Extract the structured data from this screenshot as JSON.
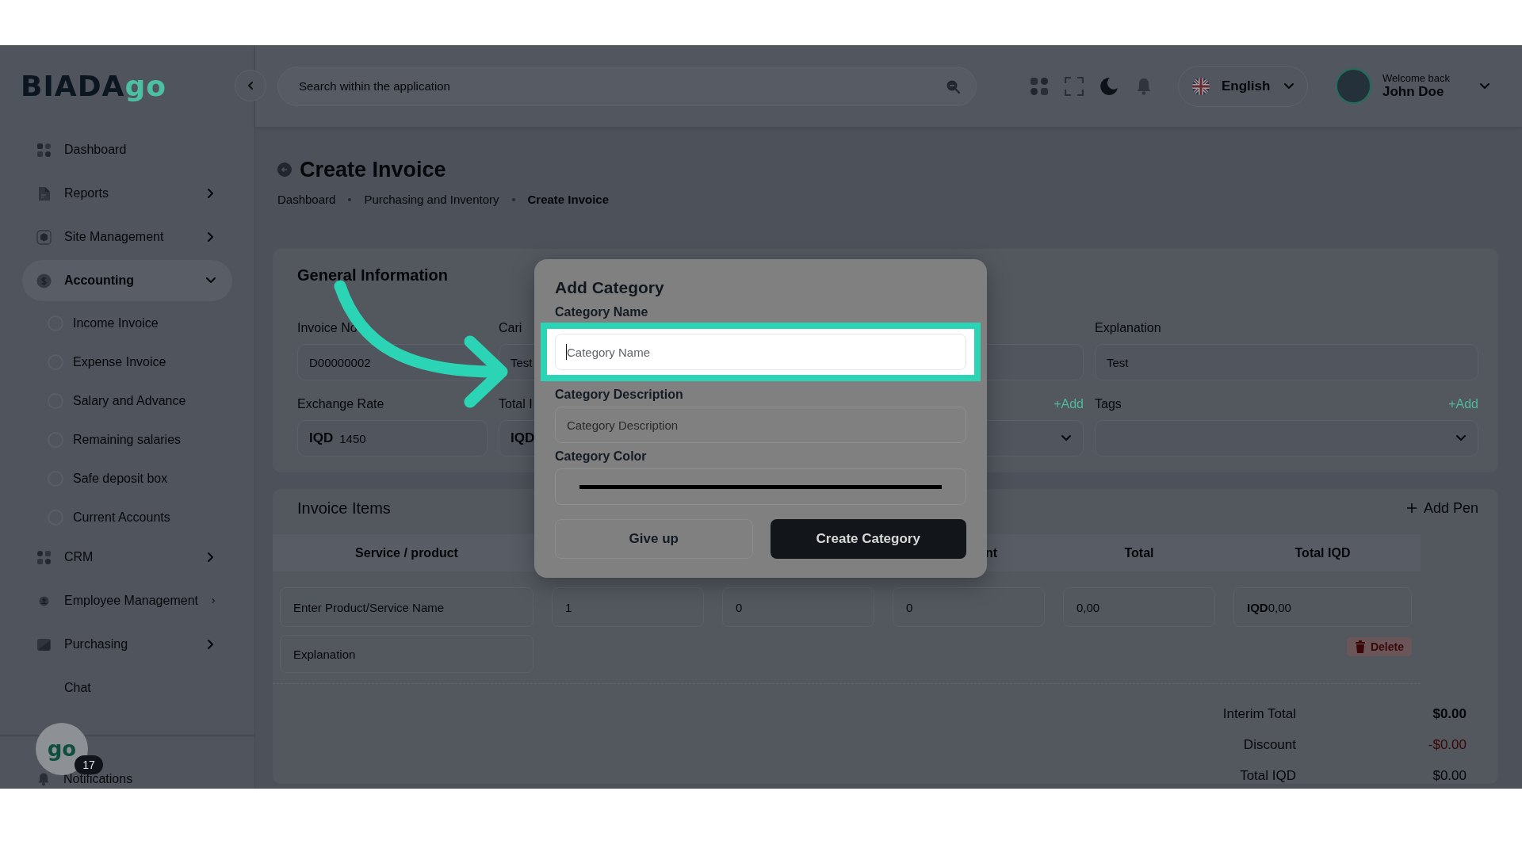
{
  "sidebar": {
    "logo": {
      "text": "BIADA",
      "accent": "go"
    },
    "items": [
      {
        "label": "Dashboard",
        "kind": "link",
        "selected": false
      },
      {
        "label": "Reports",
        "kind": "group",
        "selected": false,
        "expanded": false
      },
      {
        "label": "Site Management",
        "kind": "group",
        "selected": false,
        "expanded": false
      },
      {
        "label": "Accounting",
        "kind": "group",
        "selected": true,
        "expanded": true,
        "children": [
          {
            "label": "Income Invoice",
            "selected": false
          },
          {
            "label": "Expense Invoice",
            "selected": false
          },
          {
            "label": "Salary and Advance",
            "selected": false
          },
          {
            "label": "Remaining salaries",
            "selected": false
          },
          {
            "label": "Safe deposit box",
            "selected": false
          },
          {
            "label": "Current Accounts",
            "selected": false
          }
        ]
      },
      {
        "label": "CRM",
        "kind": "group",
        "selected": false,
        "expanded": false
      },
      {
        "label": "Employee Management",
        "kind": "group",
        "selected": false,
        "expanded": false
      },
      {
        "label": "Purchasing",
        "kind": "group",
        "selected": false,
        "expanded": false
      },
      {
        "label": "Chat",
        "kind": "link",
        "selected": false
      }
    ],
    "chat_bubble": {
      "logo": "go",
      "badge": "17"
    },
    "notifications": "Notifications"
  },
  "header": {
    "search": {
      "placeholder": "Search within the application"
    },
    "language": "English",
    "user": {
      "greeting": "Welcome back",
      "name": "John Doe"
    }
  },
  "page": {
    "title": "Create Invoice",
    "breadcrumbs": [
      {
        "label": "Dashboard",
        "current": false
      },
      {
        "label": "Purchasing and Inventory",
        "current": false
      },
      {
        "label": "Create Invoice",
        "current": true
      }
    ]
  },
  "general_information": {
    "title": "General Information",
    "fields": [
      {
        "kind": "text",
        "label": "Invoice No",
        "value": "D00000002"
      },
      {
        "kind": "text",
        "label": "Cari",
        "value": "Test"
      },
      {
        "kind": "text"
      },
      {
        "kind": "text",
        "label": "Explanation",
        "value": "Test"
      },
      {
        "kind": "currency",
        "label": "Exchange Rate",
        "currency": "IQD",
        "value": "1450"
      },
      {
        "kind": "currency",
        "label": "Total I",
        "currency": "IQD"
      },
      {
        "kind": "select",
        "add_link": "+Add"
      },
      {
        "kind": "select",
        "label": "Tags",
        "add_link": "+Add"
      }
    ]
  },
  "invoice_items": {
    "title": "Invoice Items",
    "add_button": "Add Pen",
    "columns": [
      {
        "label": "Service / product"
      },
      {},
      {},
      {
        "label": "nt"
      },
      {
        "label": "Total"
      },
      {
        "label": "Total IQD"
      }
    ],
    "rows": [
      {
        "cells": [
          {
            "placeholder": "Enter Product/Service Name"
          },
          {
            "value": "1"
          },
          {
            "value": "0"
          },
          {
            "value": "0"
          },
          {
            "value": "0,00"
          },
          {
            "currency": "IQD",
            "value": "0,00"
          }
        ],
        "explanation": {
          "placeholder": "Explanation"
        },
        "delete_button": "Delete"
      }
    ],
    "totals": [
      {
        "label": "Interim Total",
        "value": "$0.00",
        "kind": "strong"
      },
      {
        "label": "Discount",
        "value": "-$0.00",
        "kind": "negative"
      },
      {
        "label": "Total IQD",
        "value": "$0.00",
        "kind": "plain"
      }
    ]
  },
  "modal": {
    "title": "Add Category",
    "fields": [
      {
        "kind": "text",
        "label": "Category Name",
        "placeholder": "Category Name",
        "highlighted": true,
        "focused": true
      },
      {
        "kind": "text",
        "label": "Category Description",
        "placeholder": "Category Description",
        "highlighted": false,
        "focused": false
      },
      {
        "kind": "color",
        "label": "Category Color"
      }
    ],
    "buttons": [
      {
        "label": "Give up",
        "kind": "secondary"
      },
      {
        "label": "Create Category",
        "kind": "primary"
      }
    ]
  }
}
